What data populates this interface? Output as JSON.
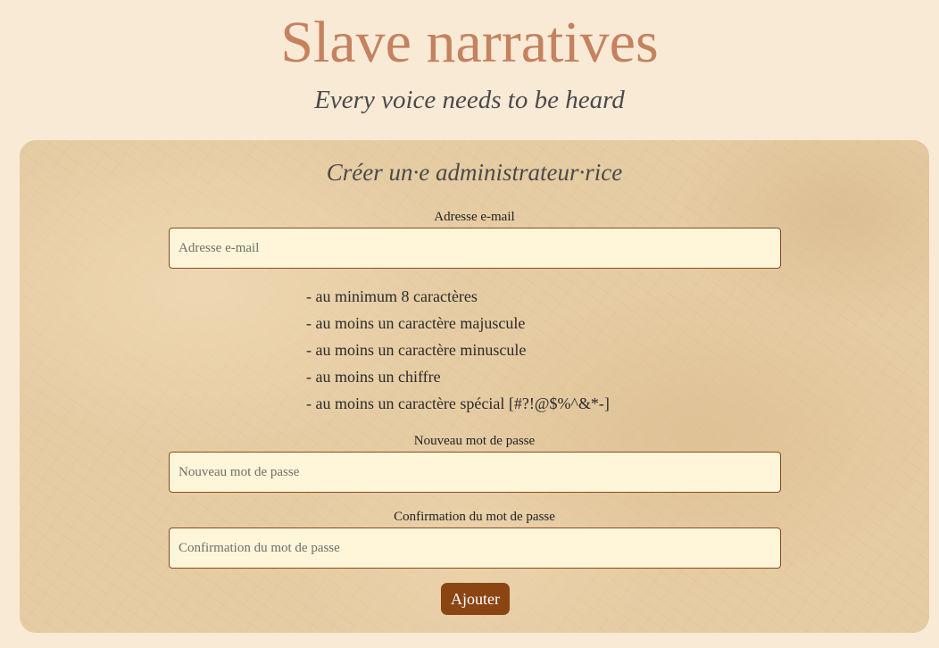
{
  "header": {
    "title": "Slave narratives",
    "subtitle": "Every voice needs to be heard"
  },
  "form": {
    "title": "Créer un·e administrateur·rice",
    "email": {
      "label": "Adresse e-mail",
      "placeholder": "Adresse e-mail",
      "value": ""
    },
    "password_rules": [
      "- au minimum 8 caractères",
      "- au moins un caractère majuscule",
      "- au moins un caractère minuscule",
      "- au moins un chiffre",
      "- au moins un caractère spécial [#?!@$%^&*-]"
    ],
    "new_password": {
      "label": "Nouveau mot de passe",
      "placeholder": "Nouveau mot de passe",
      "value": ""
    },
    "confirm_password": {
      "label": "Confirmation du mot de passe",
      "placeholder": "Confirmation du mot de passe",
      "value": ""
    },
    "submit_label": "Ajouter"
  },
  "colors": {
    "page_background": "#f9ead6",
    "title": "#c4825f",
    "button": "#8b4513",
    "input_border": "#8b4a22",
    "input_background": "#fff6d9"
  }
}
